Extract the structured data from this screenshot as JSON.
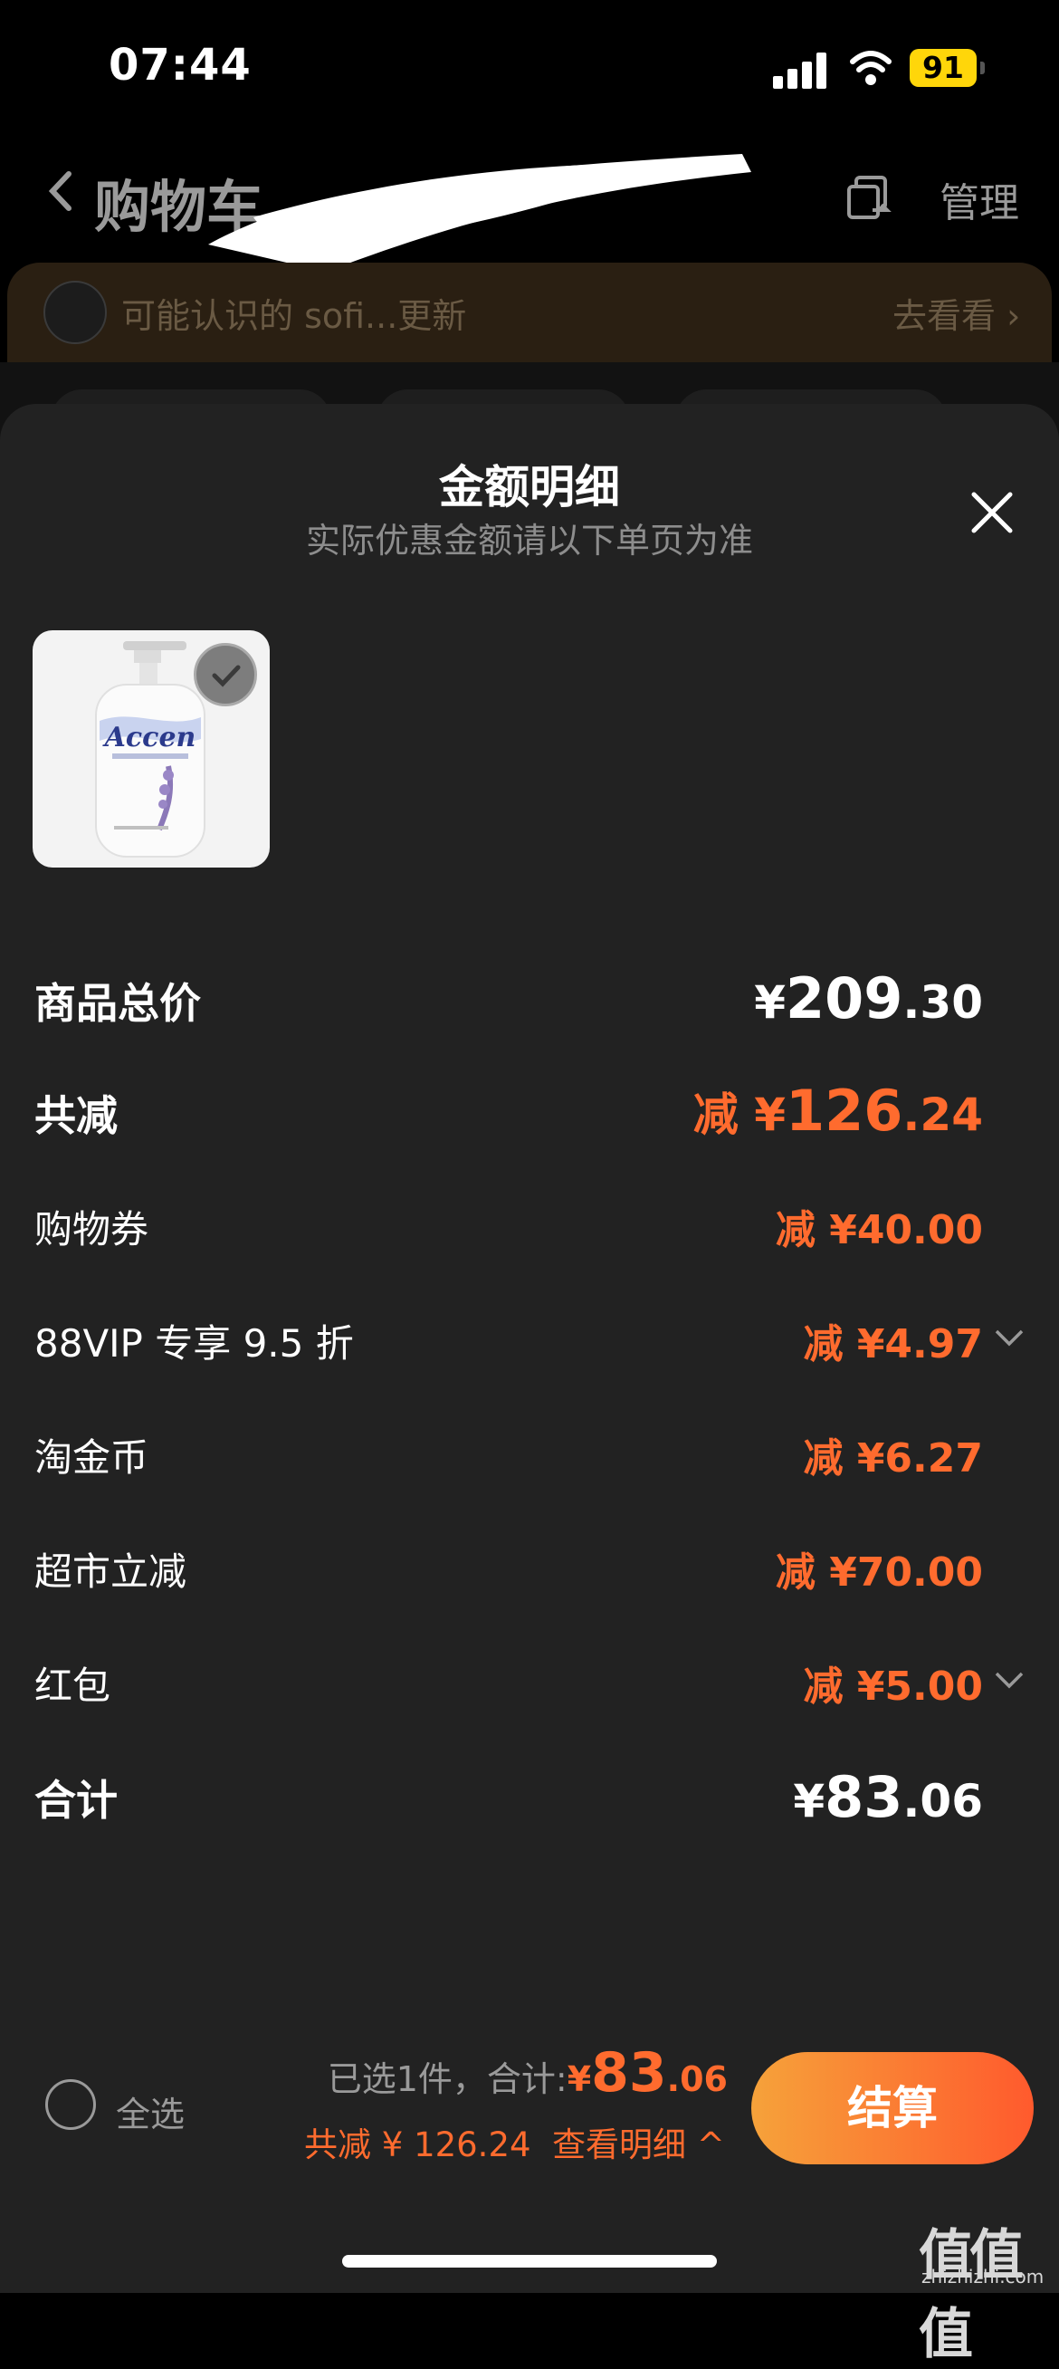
{
  "status_bar": {
    "time": "07:44",
    "battery": "91"
  },
  "nav": {
    "title": "购物车",
    "manage": "管理"
  },
  "notification": {
    "text": "可能认识的 sofi...更新",
    "link": "去看看 ›"
  },
  "sheet": {
    "title": "金额明细",
    "subtitle": "实际优惠金额请以下单页为准",
    "product": {
      "brand_text": "Accen",
      "selected": true
    },
    "total_price": {
      "label": "商品总价",
      "currency": "¥",
      "int": "209",
      "dec": ".30"
    },
    "total_discount": {
      "label": "共减",
      "prefix": "减 ¥",
      "int": "126",
      "dec": ".24"
    },
    "discounts": [
      {
        "label": "购物券",
        "value": "减 ¥40.00",
        "expandable": false
      },
      {
        "label": "88VIP 专享 9.5 折",
        "value": "减 ¥4.97",
        "expandable": true
      },
      {
        "label": "淘金币",
        "value": "减 ¥6.27",
        "expandable": false
      },
      {
        "label": "超市立减",
        "value": "减 ¥70.00",
        "expandable": false
      },
      {
        "label": "红包",
        "value": "减 ¥5.00",
        "expandable": true
      }
    ],
    "grand_total": {
      "label": "合计",
      "currency": "¥",
      "int": "83",
      "dec": ".06"
    }
  },
  "bottom_bar": {
    "select_all": "全选",
    "selected_prefix": "已选1件，合计:",
    "currency": "¥",
    "total_int": "83",
    "total_dec": ".06",
    "saved_text": "共减 ¥ 126.24",
    "detail_link": "查看明细 ^",
    "checkout": "结算"
  },
  "watermark": {
    "main": "值值值",
    "sub": "zhizhizhi.com"
  },
  "colors": {
    "accent": "#ff6b2e",
    "sheet_bg": "#222222",
    "checkout_from": "#f6a23a",
    "checkout_to": "#ff5a2d"
  }
}
